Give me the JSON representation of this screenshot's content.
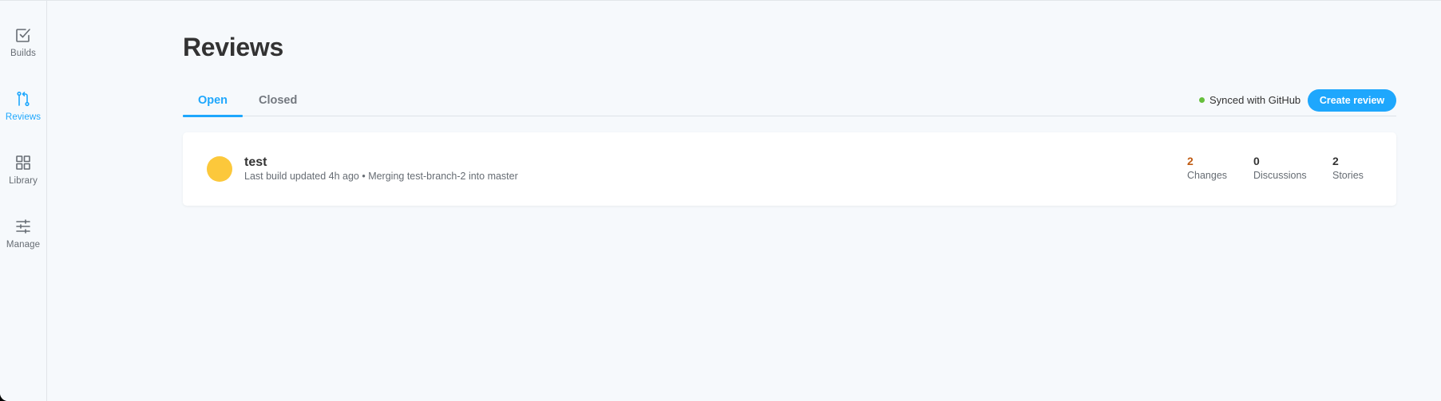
{
  "sidebar": {
    "items": [
      {
        "label": "Builds",
        "icon": "checkbox-icon",
        "active": false
      },
      {
        "label": "Reviews",
        "icon": "pull-request-icon",
        "active": true
      },
      {
        "label": "Library",
        "icon": "grid-icon",
        "active": false
      },
      {
        "label": "Manage",
        "icon": "sliders-icon",
        "active": false
      }
    ]
  },
  "page": {
    "title": "Reviews"
  },
  "tabs": [
    {
      "label": "Open",
      "active": true
    },
    {
      "label": "Closed",
      "active": false
    }
  ],
  "sync": {
    "label": "Synced with GitHub",
    "status_color": "#66bf3c"
  },
  "create_button": {
    "label": "Create review"
  },
  "reviews": [
    {
      "title": "test",
      "subtitle": "Last build updated 4h ago • Merging test-branch-2 into master",
      "avatar_color": "#fcc83b",
      "stats": [
        {
          "value": "2",
          "label": "Changes",
          "color": "#c05b12"
        },
        {
          "value": "0",
          "label": "Discussions"
        },
        {
          "value": "2",
          "label": "Stories"
        }
      ]
    }
  ],
  "colors": {
    "accent": "#1ea7fd",
    "background": "#f6f9fc"
  }
}
